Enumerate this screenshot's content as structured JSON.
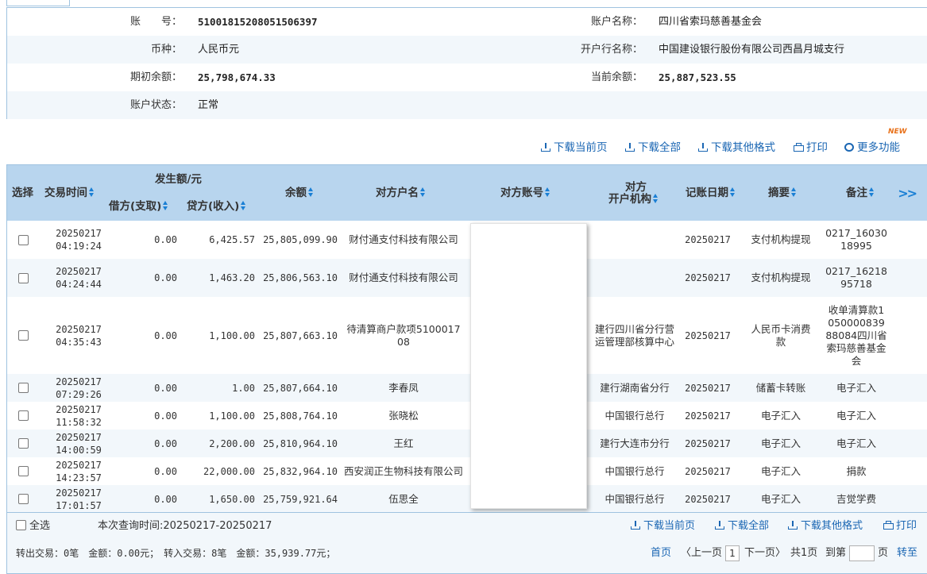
{
  "account": {
    "number_label": "账　　号：",
    "number": "51001815208051506397",
    "name_label": "账户名称：",
    "name": "四川省索玛慈善基金会",
    "currency_label": "币种：",
    "currency": "人民币元",
    "bank_label": "开户行名称：",
    "bank": "中国建设银行股份有限公司西昌月城支行",
    "opening_label": "期初余额：",
    "opening": "25,798,674.33",
    "current_label": "当前余额：",
    "current": "25,887,523.55",
    "status_label": "账户状态：",
    "status": "正常"
  },
  "toolbar": {
    "download_page": "下载当前页",
    "download_all": "下载全部",
    "download_other": "下载其他格式",
    "print": "打印",
    "more": "更多功能",
    "new_badge": "NEW"
  },
  "table": {
    "headers": {
      "select": "选择",
      "time": "交易时间",
      "amount_group": "发生额/元",
      "debit": "借方(支取)",
      "credit": "贷方(收入)",
      "balance": "余额",
      "counterparty": "对方户名",
      "counter_account": "对方账号",
      "counter_bank_1": "对方",
      "counter_bank_2": "开户机构",
      "book_date": "记账日期",
      "summary": "摘要",
      "remark": "备注"
    },
    "rows": [
      {
        "date": "20250217",
        "time": "04:19:24",
        "debit": "0.00",
        "credit": "6,425.57",
        "balance": "25,805,099.90",
        "name": "财付通支付科技有限公司",
        "bank": "",
        "book": "20250217",
        "summary": "支付机构提现",
        "remark": "0217_1603018995"
      },
      {
        "date": "20250217",
        "time": "04:24:44",
        "debit": "0.00",
        "credit": "1,463.20",
        "balance": "25,806,563.10",
        "name": "财付通支付科技有限公司",
        "bank": "",
        "book": "20250217",
        "summary": "支付机构提现",
        "remark": "0217_1621895718"
      },
      {
        "date": "20250217",
        "time": "04:35:43",
        "debit": "0.00",
        "credit": "1,100.00",
        "balance": "25,807,663.10",
        "name": "待清算商户款项510001708",
        "bank": "建行四川省分行营运管理部核算中心",
        "book": "20250217",
        "summary": "人民币卡消费款",
        "remark": "收单清算款105000083988084四川省索玛慈善基金会"
      },
      {
        "date": "20250217",
        "time": "07:29:26",
        "debit": "0.00",
        "credit": "1.00",
        "balance": "25,807,664.10",
        "name": "李春凤",
        "bank": "建行湖南省分行",
        "book": "20250217",
        "summary": "储蓄卡转账",
        "remark": "电子汇入"
      },
      {
        "date": "20250217",
        "time": "11:58:32",
        "debit": "0.00",
        "credit": "1,100.00",
        "balance": "25,808,764.10",
        "name": "张晓松",
        "bank": "中国银行总行",
        "book": "20250217",
        "summary": "电子汇入",
        "remark": "电子汇入"
      },
      {
        "date": "20250217",
        "time": "14:00:59",
        "debit": "0.00",
        "credit": "2,200.00",
        "balance": "25,810,964.10",
        "name": "王红",
        "bank": "建行大连市分行",
        "book": "20250217",
        "summary": "电子汇入",
        "remark": "电子汇入"
      },
      {
        "date": "20250217",
        "time": "14:23:57",
        "debit": "0.00",
        "credit": "22,000.00",
        "balance": "25,832,964.10",
        "name": "西安润正生物科技有限公司",
        "bank": "中国银行总行",
        "book": "20250217",
        "summary": "电子汇入",
        "remark": "捐款"
      },
      {
        "date": "20250217",
        "time": "17:01:57",
        "debit": "0.00",
        "credit": "1,650.00",
        "balance": "25,759,921.64",
        "name": "伍思全",
        "bank": "中国银行总行",
        "book": "20250217",
        "summary": "电子汇入",
        "remark": "吉觉学费"
      }
    ]
  },
  "footer": {
    "select_all": "全选",
    "query_time": "本次查询时间:20250217-20250217",
    "download_page": "下载当前页",
    "download_all": "下载全部",
    "download_other": "下载其他格式",
    "print": "打印",
    "summary": "转出交易：0笔　金额：0.00元；　转入交易：8笔　金额：35,939.77元；",
    "first": "首页",
    "prev": "〈上一页",
    "page": "1",
    "next": "下一页〉",
    "total": "共1页",
    "goto": "到第",
    "page_unit": "页",
    "go": "转至"
  }
}
